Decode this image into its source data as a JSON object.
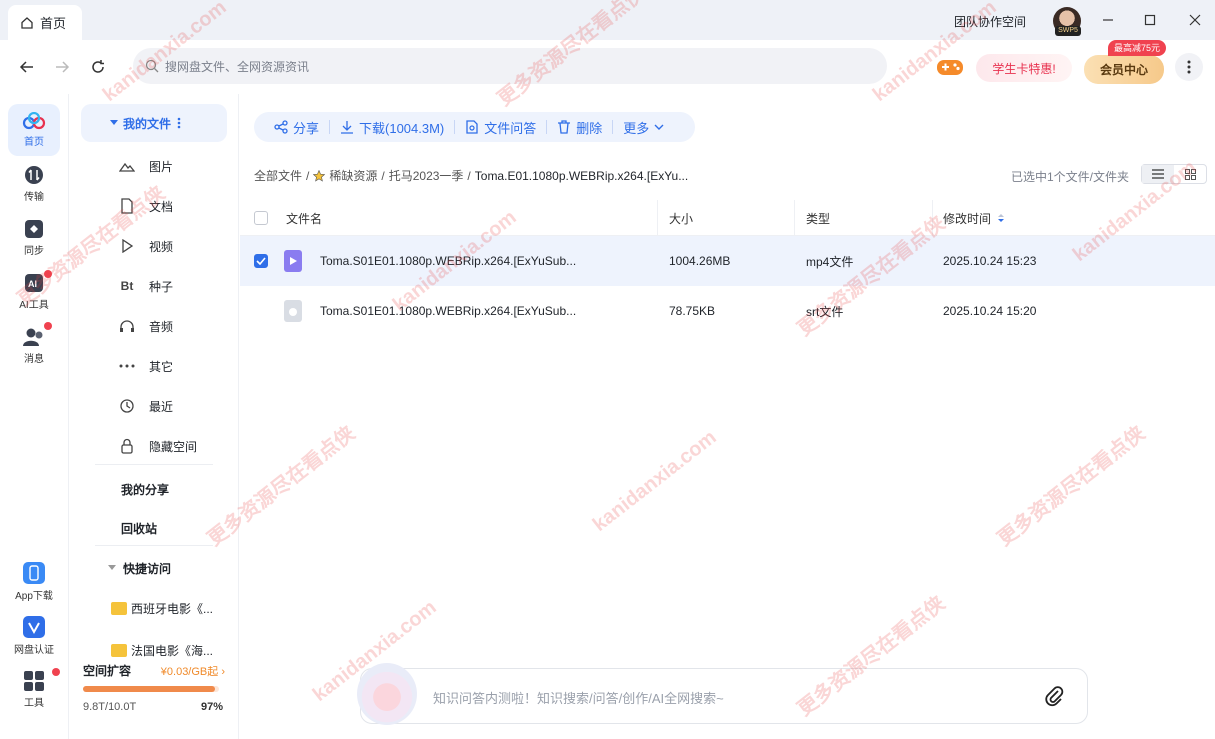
{
  "window": {
    "tab_label": "首页",
    "team_space": "团队协作空间",
    "avatar_badge": "SWP5"
  },
  "toolbar": {
    "search_placeholder": "搜网盘文件、全网资源资讯",
    "student_card": "学生卡特惠!",
    "member_center": "会员中心",
    "discount_tag": "最高减75元"
  },
  "rail": {
    "items": [
      {
        "label": "首页",
        "icon": "cloud-logo-icon",
        "active": true
      },
      {
        "label": "传输",
        "icon": "transfer-icon"
      },
      {
        "label": "同步",
        "icon": "sync-icon"
      },
      {
        "label": "AI工具",
        "icon": "ai-tools-icon"
      },
      {
        "label": "消息",
        "icon": "message-icon"
      },
      {
        "label": "App下载",
        "icon": "app-download-icon"
      },
      {
        "label": "网盘认证",
        "icon": "verify-icon"
      },
      {
        "label": "工具",
        "icon": "tools-icon"
      }
    ]
  },
  "sidebar": {
    "my_files": "我的文件",
    "items": [
      {
        "label": "图片",
        "icon": "image-icon"
      },
      {
        "label": "文档",
        "icon": "document-icon"
      },
      {
        "label": "视频",
        "icon": "video-icon"
      },
      {
        "label": "种子",
        "icon": "torrent-icon"
      },
      {
        "label": "音频",
        "icon": "audio-icon"
      },
      {
        "label": "其它",
        "icon": "other-icon"
      },
      {
        "label": "最近",
        "icon": "recent-icon"
      },
      {
        "label": "隐藏空间",
        "icon": "lock-icon"
      }
    ],
    "my_share": "我的分享",
    "recycle": "回收站",
    "quick_access": "快捷访问",
    "quick_items": [
      "西班牙电影《...",
      "法国电影《海..."
    ],
    "space": {
      "title": "空间扩容",
      "price": "¥0.03/GB起",
      "usage": "9.8T/10.0T",
      "percent": "97%",
      "percent_value": 97
    }
  },
  "main": {
    "actions": [
      "分享",
      "下载(1004.3M)",
      "文件问答",
      "删除",
      "更多"
    ],
    "breadcrumb": [
      "全部文件",
      "稀缺资源",
      "托马2023一季",
      "Toma.E01.1080p.WEBRip.x264.[ExYu..."
    ],
    "selection_status": "已选中1个文件/文件夹",
    "columns": [
      "文件名",
      "大小",
      "类型",
      "修改时间"
    ],
    "rows": [
      {
        "name": "Toma.S01E01.1080p.WEBRip.x264.[ExYuSub...",
        "size": "1004.26MB",
        "type": "mp4文件",
        "modified": "2025.10.24 15:23",
        "selected": true
      },
      {
        "name": "Toma.S01E01.1080p.WEBRip.x264.[ExYuSub...",
        "size": "78.75KB",
        "type": "srt文件",
        "modified": "2025.10.24 15:20",
        "selected": false
      }
    ],
    "ai_placeholder": "知识问答内测啦！知识搜索/问答/创作/AI全网搜索~"
  },
  "watermark": [
    "kanidanxia.com",
    "更多资源尽在看点侠"
  ],
  "colors": {
    "accent": "#2f6ee8",
    "danger": "#f0424f",
    "gold": "#f6c98a"
  }
}
